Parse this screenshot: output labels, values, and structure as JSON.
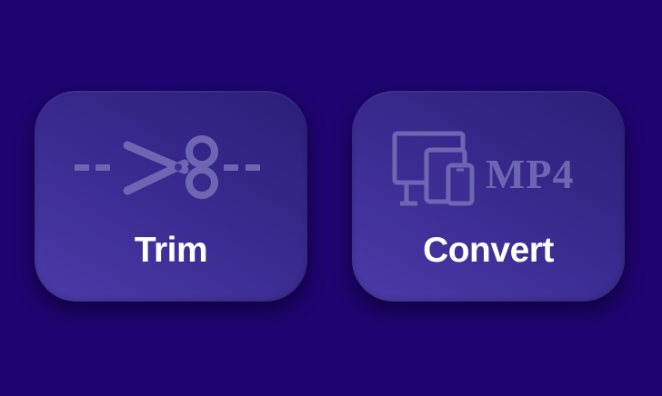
{
  "tiles": [
    {
      "label": "Trim",
      "icon": "scissors-cut-line-icon"
    },
    {
      "label": "Convert",
      "icon": "devices-icon",
      "badge_text": "MP4"
    }
  ],
  "colors": {
    "background": "#1e0470",
    "tile_gradient_start": "#4d3aa8",
    "tile_gradient_end": "#2b1e78",
    "icon_color": "#6e66b3",
    "label_color": "#ffffff"
  }
}
